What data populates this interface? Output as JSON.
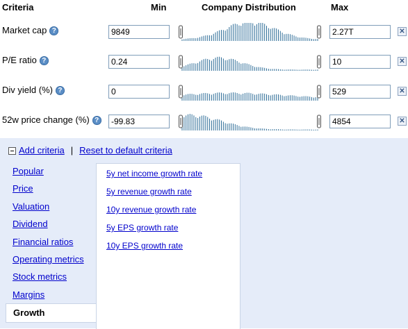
{
  "header": {
    "criteria": "Criteria",
    "min": "Min",
    "distribution": "Company Distribution",
    "max": "Max"
  },
  "rows": [
    {
      "label": "Market cap",
      "min": "9849",
      "max": "2.27T",
      "help_icon": "question-icon",
      "remove_icon": "close-icon"
    },
    {
      "label": "P/E ratio",
      "min": "0.24",
      "max": "10",
      "help_icon": "question-icon",
      "remove_icon": "close-icon"
    },
    {
      "label": "Div yield (%)",
      "min": "0",
      "max": "529",
      "help_icon": "question-icon",
      "remove_icon": "close-icon"
    },
    {
      "label": "52w price change (%)",
      "min": "-99.83",
      "max": "4854",
      "help_icon": "question-icon",
      "remove_icon": "close-icon"
    }
  ],
  "help_glyph": "?",
  "remove_glyph": "✕",
  "actions": {
    "add": "Add criteria",
    "separator": "|",
    "reset": "Reset to default criteria"
  },
  "categories": [
    "Popular",
    "Price",
    "Valuation",
    "Dividend",
    "Financial ratios",
    "Operating metrics",
    "Stock metrics",
    "Margins",
    "Growth"
  ],
  "selected_category": "Growth",
  "growth_options": [
    "5y net income growth rate",
    "5y revenue growth rate",
    "10y revenue growth rate",
    "5y EPS growth rate",
    "10y EPS growth rate"
  ],
  "colors": {
    "histogram": "#2b6b96",
    "link": "#0000cc",
    "panel": "#e5ecf9"
  }
}
